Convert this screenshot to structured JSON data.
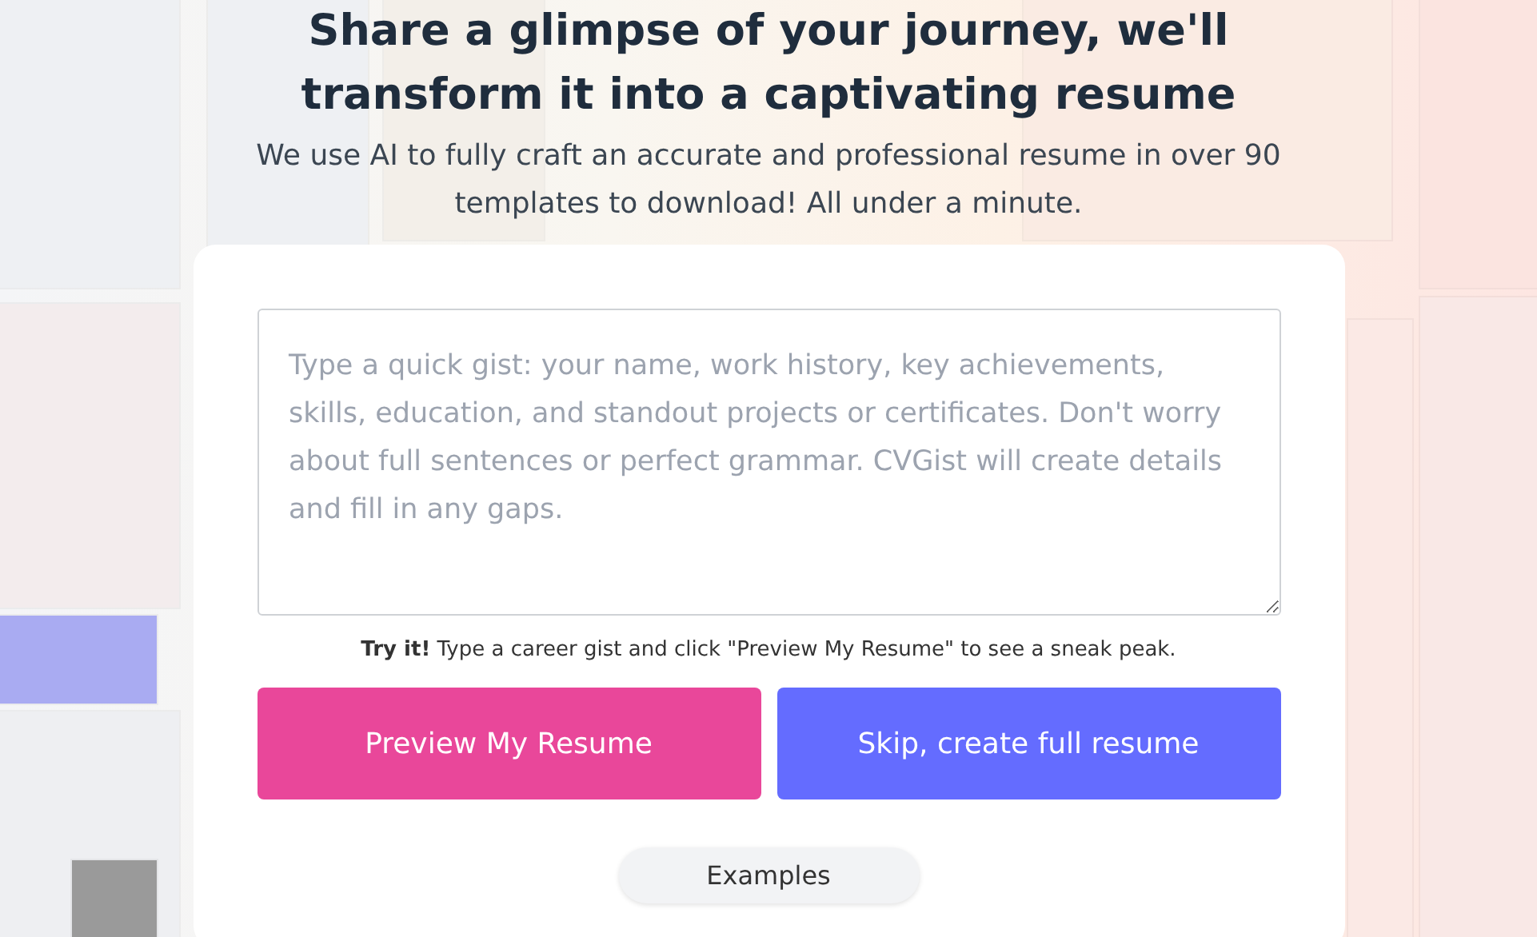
{
  "heading": "Share a glimpse of your journey, we'll transform it into a captivating resume",
  "subtitle": "We use AI to fully craft an accurate and professional resume in over 90 templates to download! All under a minute.",
  "gist_field": {
    "placeholder": "Type a quick gist: your name, work history, key achievements, skills, education, and standout projects or certificates. Don't worry about full sentences or perfect grammar. CVGist will create details and fill in any gaps."
  },
  "hint": "**Try it!** Type a career gist and click \"Preview My Resume\" to see a sneak peak.",
  "buttons": [
    {
      "label": "Preview My Resume",
      "kind": "primary"
    },
    {
      "label": "Skip, create full resume",
      "kind": "secondary"
    }
  ],
  "examples_button": "Examples"
}
